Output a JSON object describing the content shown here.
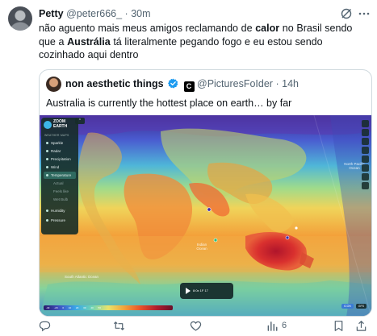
{
  "tweet": {
    "display_name": "Petty",
    "handle": "@peter666_",
    "separator": "·",
    "time": "30m",
    "text_part1": "não aguento mais meus amigos reclamando de ",
    "text_bold1": "calor",
    "text_part2": " no Brasil sendo que a ",
    "text_bold2": "Austrália",
    "text_part3": " tá literalmente pegando fogo e eu estou sendo cozinhado aqui dentro"
  },
  "quote": {
    "display_name": "non aesthetic things",
    "affiliate_badge": "C",
    "handle": "@PicturesFoIder",
    "separator": "·",
    "time": "14h",
    "text": "Australia is currently the hottest place on earth… by far"
  },
  "map_app": {
    "brand": "ZOOM EARTH",
    "toggle": "⌃",
    "section_title": "WEATHER MAPS",
    "menu": [
      {
        "label": "Sparkle",
        "active": false,
        "sub": false
      },
      {
        "label": "Radar",
        "active": false,
        "sub": false
      },
      {
        "label": "Precipitation",
        "active": false,
        "sub": false
      },
      {
        "label": "Wind",
        "active": false,
        "sub": false
      },
      {
        "label": "Temperature",
        "active": true,
        "sub": false
      },
      {
        "label": "Actual",
        "active": false,
        "sub": true
      },
      {
        "label": "Feels like",
        "active": false,
        "sub": true
      },
      {
        "label": "Wet Bulb",
        "active": false,
        "sub": true
      },
      {
        "label": "Humidity",
        "active": false,
        "sub": false
      },
      {
        "label": "Pressure",
        "active": false,
        "sub": false
      }
    ],
    "place_labels": {
      "north_pacific": "North Pacific Ocean",
      "indian": "Indian Ocean",
      "south_atlantic": "South Atlantic Ocean"
    },
    "playback": {
      "times": "8:0x  1F  17"
    },
    "legend_ticks": "-40 -20 0 10 20 30 40 50",
    "badges": [
      "ICON",
      "GFS"
    ]
  },
  "actions": {
    "reply_count": "",
    "retweet_count": "",
    "like_count": "",
    "views_count": "6"
  },
  "colors": {
    "handle_gray": "#536471",
    "verified_blue": "#1d9bf0",
    "border": "#cfd9de"
  }
}
